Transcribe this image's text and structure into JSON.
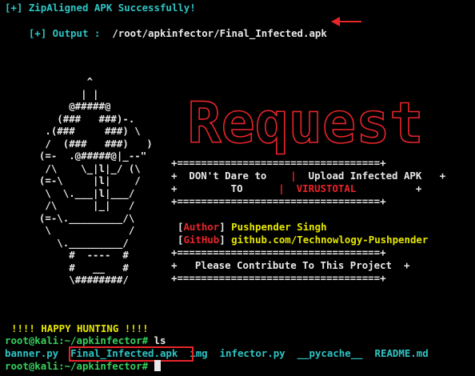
{
  "lines": {
    "zipaligned": "[+] ZipAligned APK Successfully!",
    "output_prefix": "[+] Output :",
    "output_path": "/root/apkinfector/Final_Infected.apk"
  },
  "ascii_art": "          ^\n         | |\n       @#####@\n     (###   ###)-.\n   .(###     ###) \\\n   /  (###   ###)   )\n  (=-  .@#####@|_--\"\n   /\\    \\_|l|_/ (\\\n  (=-\\     |l|    /\n   \\  \\.___|l|___/\n   /\\      |_|   /\n  (=-\\._________/\\\n   \\             /\n     \\._________/\n       #  ----  #\n       #   __   #\n       \\########/",
  "banner": {
    "title": "Request",
    "sep": "+==================================+",
    "row1_left": "DON't Dare to",
    "row1_right": "Upload Infected APK",
    "row2_left": "TO",
    "row2_right": "VIRUSTOTAL",
    "author_label": "Author",
    "author_value": "Pushpender Singh",
    "github_label": "GitHub",
    "github_value": "github.com/Technowlogy-Pushpender",
    "contribute": "Please Contribute To This Project"
  },
  "footer": {
    "happy": "!!!! HAPPY HUNTING !!!!",
    "prompt": "root@kali:~/apkinfector#",
    "cmd_ls": "ls",
    "files": [
      "banner.py",
      "Final_Infected.apk",
      "img",
      "infector.py",
      "__pycache__",
      "README.md"
    ]
  },
  "colors": {
    "background": "#000000",
    "cyan": "#2fc4c4",
    "red": "#e8242a",
    "green": "#36d05c",
    "yellow": "#e6e600",
    "white": "#e8e8e8"
  }
}
